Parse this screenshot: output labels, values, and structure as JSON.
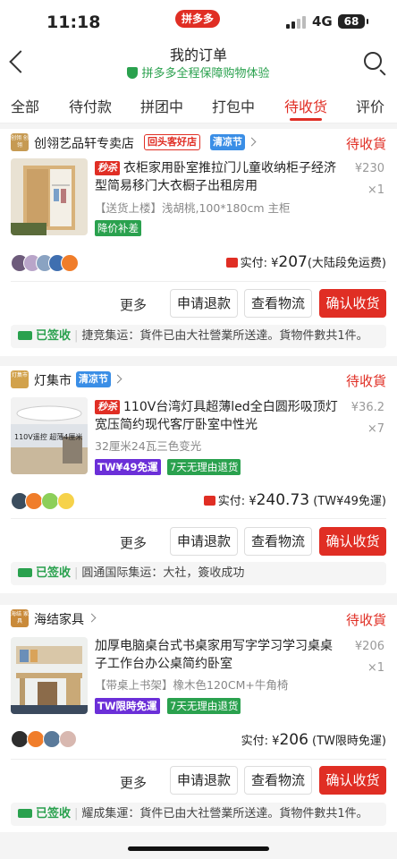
{
  "status_bar": {
    "time": "11:18",
    "app_badge": "拼多多",
    "network": "4G",
    "battery": "68"
  },
  "header": {
    "title": "我的订单",
    "subtitle": "拼多多全程保障购物体验"
  },
  "tabs": [
    {
      "label": "全部"
    },
    {
      "label": "待付款"
    },
    {
      "label": "拼团中"
    },
    {
      "label": "打包中"
    },
    {
      "label": "待收货",
      "active": true
    },
    {
      "label": "评价"
    }
  ],
  "actions": {
    "more": "更多",
    "refund": "申请退款",
    "logistics": "查看物流",
    "confirm": "确认收货"
  },
  "orders": [
    {
      "shop_logo": "创翎 创翎",
      "shop": "创翎艺品轩专卖店",
      "tag1": "回头客好店",
      "tag2": "清凉节",
      "status": "待收貨",
      "promo": "秒杀",
      "title": "衣柜家用卧室推拉门儿童收纳柜子经济型简易移门大衣橱子出租房用",
      "spec": "【送货上楼】浅胡桃,100*180cm 主柜",
      "unit_price": "¥230",
      "qty": "×1",
      "badges": [
        "降价补差"
      ],
      "paid_label": "实付:",
      "paid_currency": "¥",
      "paid_amount": "207",
      "paid_note": "(大陆段免运费)",
      "logistics_status": "已签收",
      "logistics_text": "捷竞集运：貨件已由大社營業所送達。貨物件數共1件。"
    },
    {
      "shop_logo": "灯集市",
      "shop": "灯集市",
      "tag2": "清凉节",
      "status": "待收貨",
      "promo": "秒杀",
      "title": "110V台湾灯具超薄led全白圆形吸顶灯宽压简约现代客厅卧室中性光",
      "spec": "32厘米24瓦三色变光",
      "thumb_text": "110V遥控 超薄4厘米",
      "unit_price": "¥36.2",
      "qty": "×7",
      "badges": [
        "TW¥49免運",
        "7天无理由退货"
      ],
      "paid_label": "实付:",
      "paid_currency": "¥",
      "paid_amount": "240.73",
      "paid_note": "(TW¥49免運)",
      "logistics_status": "已签收",
      "logistics_text": "圓通国际集运：大社，簽收成功"
    },
    {
      "shop_logo": "海结 家具",
      "shop": "海结家具",
      "status": "待收貨",
      "title": "加厚电脑桌台式书桌家用写字学习学习桌桌子工作台办公桌简约卧室",
      "spec": "【带桌上书架】橡木色120CM+牛角椅",
      "unit_price": "¥206",
      "qty": "×1",
      "badges": [
        "TW限時免運",
        "7天无理由退货"
      ],
      "paid_label": "实付:",
      "paid_currency": "¥",
      "paid_amount": "206",
      "paid_note": "(TW限時免運)",
      "logistics_status": "已签收",
      "logistics_text": "耀成集運：貨件已由大社營業所送達。貨物件數共1件。"
    }
  ],
  "colors": {
    "brand_red": "#e02e24",
    "green": "#2aa14e",
    "blue_tag": "#3a8ee6",
    "purple_badge": "#6b2fd8"
  }
}
